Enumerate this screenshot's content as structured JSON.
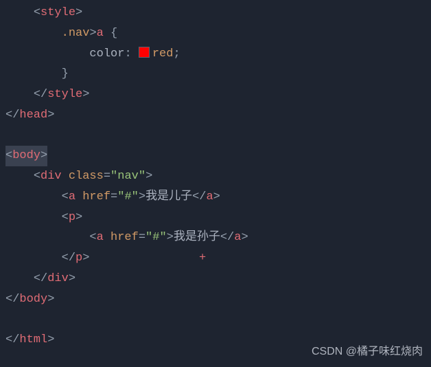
{
  "code": {
    "line1": {
      "indent": "    ",
      "open": "<",
      "tag": "style",
      "close": ">"
    },
    "line2": {
      "indent": "        ",
      "sel_class": ".nav",
      "combinator": ">",
      "sel_tag": "a",
      "space": " ",
      "brace": "{"
    },
    "line3": {
      "indent": "            ",
      "prop": "color",
      "colon": ": ",
      "value": "red",
      "semi": ";"
    },
    "line4": {
      "indent": "        ",
      "brace": "}"
    },
    "line5": {
      "indent": "    ",
      "open": "</",
      "tag": "style",
      "close": ">"
    },
    "line6": {
      "indent": "",
      "open": "</",
      "tag": "head",
      "close": ">"
    },
    "line8": {
      "indent": "",
      "open": "<",
      "tag": "body",
      "close": ">"
    },
    "line9": {
      "indent": "    ",
      "open": "<",
      "tag": "div",
      "space": " ",
      "attr": "class",
      "eq": "=",
      "val": "\"nav\"",
      "close": ">"
    },
    "line10": {
      "indent": "        ",
      "open": "<",
      "tag": "a",
      "space": " ",
      "attr": "href",
      "eq": "=",
      "val": "\"#\"",
      "close": ">",
      "text": "我是儿子",
      "open2": "</",
      "tag2": "a",
      "close2": ">"
    },
    "line11": {
      "indent": "        ",
      "open": "<",
      "tag": "p",
      "close": ">"
    },
    "line12": {
      "indent": "            ",
      "open": "<",
      "tag": "a",
      "space": " ",
      "attr": "href",
      "eq": "=",
      "val": "\"#\"",
      "close": ">",
      "text": "我是孙子",
      "open2": "</",
      "tag2": "a",
      "close2": ">"
    },
    "line13": {
      "indent": "        ",
      "open": "</",
      "tag": "p",
      "close": ">",
      "cursor": "+"
    },
    "line14": {
      "indent": "    ",
      "open": "</",
      "tag": "div",
      "close": ">"
    },
    "line15": {
      "indent": "",
      "open": "</",
      "tag": "body",
      "close": ">"
    },
    "line17": {
      "indent": "",
      "open": "</",
      "tag": "html",
      "close": ">"
    }
  },
  "watermark": "CSDN @橘子味红烧肉",
  "swatch_color": "#ff0000"
}
